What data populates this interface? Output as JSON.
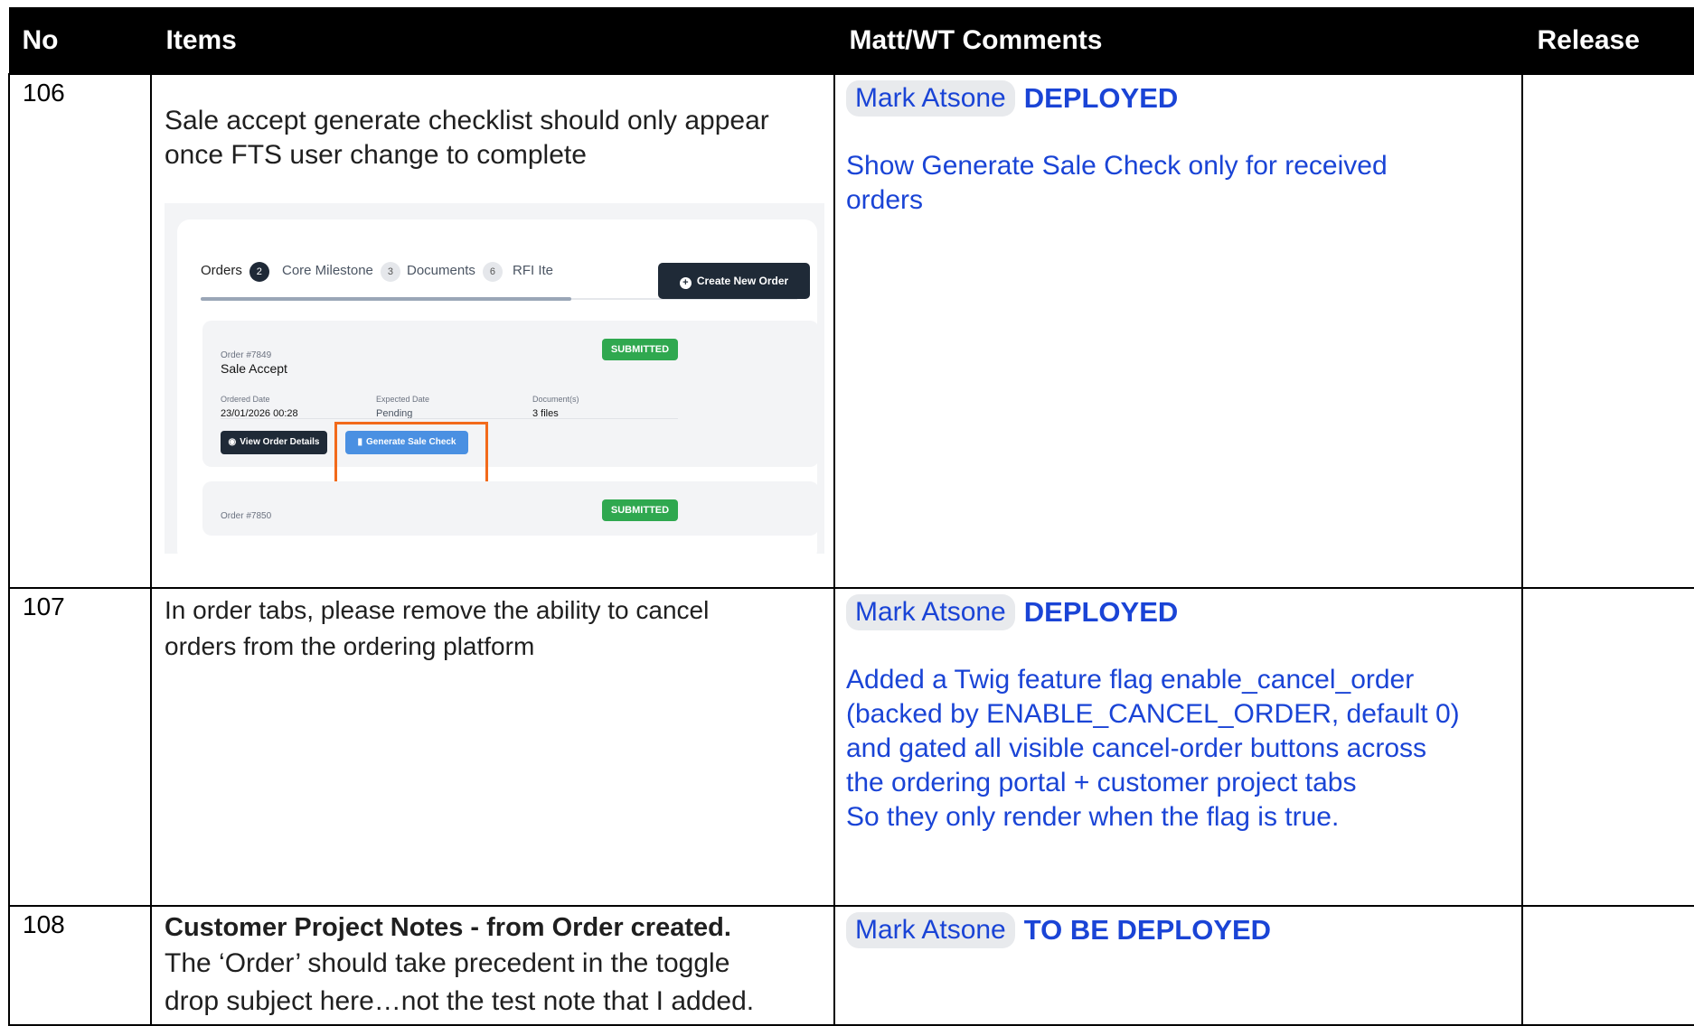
{
  "header": {
    "no": "No",
    "items": "Items",
    "comments": "Matt/WT Comments",
    "release": "Release"
  },
  "rows": [
    {
      "no": "106",
      "item_text": "Sale accept generate checklist should only appear once FTS user change to complete",
      "assignee": "Mark Atsone",
      "status": "DEPLOYED",
      "comment_lines": [
        "Show Generate Sale Check only for received",
        "orders"
      ],
      "release": "",
      "screenshot": {
        "tabs": [
          {
            "label": "Orders",
            "count": "2"
          },
          {
            "label": "Core Milestone",
            "count": "3"
          },
          {
            "label": "Documents",
            "count": "6"
          },
          {
            "label": "RFI Ite",
            "count": ""
          }
        ],
        "create_button": "Create New Order",
        "orders": [
          {
            "number": "Order #7849",
            "name": "Sale Accept",
            "status": "SUBMITTED",
            "ordered_label": "Ordered Date",
            "ordered_value": "23/01/2026 00:28",
            "expected_label": "Expected Date",
            "expected_value": "Pending",
            "documents_label": "Document(s)",
            "documents_value": "3 files",
            "view_button": "View Order Details",
            "generate_button": "Generate Sale Check"
          },
          {
            "number": "Order #7850",
            "status": "SUBMITTED"
          }
        ],
        "highlight_color": "#f26a1b"
      }
    },
    {
      "no": "107",
      "item_lines": [
        "In order tabs, please remove the ability to cancel",
        "orders from the ordering platform"
      ],
      "assignee": "Mark Atsone",
      "status": "DEPLOYED",
      "comment_lines": [
        "Added a Twig feature flag enable_cancel_order",
        "(backed by ENABLE_CANCEL_ORDER, default 0)",
        "and gated all visible cancel-order buttons across",
        "the ordering portal + customer project tabs",
        "So they only render when the flag is true."
      ],
      "release": ""
    },
    {
      "no": "108",
      "item_title": "Customer Project Notes - from Order created.",
      "item_lines": [
        "The ‘Order’ should take precedent in the toggle",
        "drop subject here…not the test note that I added."
      ],
      "assignee": "Mark Atsone",
      "status": "TO BE DEPLOYED",
      "release": ""
    }
  ],
  "colors": {
    "header_bg": "#000000",
    "comment_blue": "#1a44d6",
    "chip_bg": "#e8eaed",
    "submitted_green": "#2fa84f",
    "generate_blue": "#4a90e2"
  }
}
